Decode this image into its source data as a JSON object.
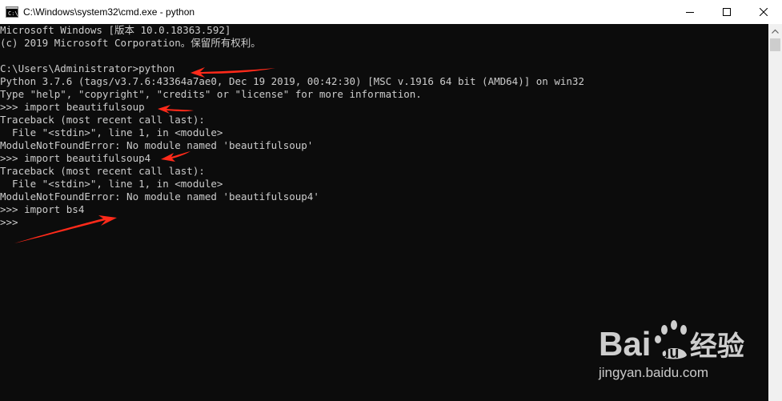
{
  "window": {
    "title": "C:\\Windows\\system32\\cmd.exe - python",
    "app_icon": "cmd-icon",
    "controls": {
      "minimize_icon": "minimize-icon",
      "maximize_icon": "maximize-icon",
      "close_icon": "close-icon"
    }
  },
  "console": {
    "lines": [
      "Microsoft Windows [版本 10.0.18363.592]",
      "(c) 2019 Microsoft Corporation。保留所有权利。",
      "",
      "C:\\Users\\Administrator>python",
      "Python 3.7.6 (tags/v3.7.6:43364a7ae0, Dec 19 2019, 00:42:30) [MSC v.1916 64 bit (AMD64)] on win32",
      "Type \"help\", \"copyright\", \"credits\" or \"license\" for more information.",
      ">>> import beautifulsoup",
      "Traceback (most recent call last):",
      "  File \"<stdin>\", line 1, in <module>",
      "ModuleNotFoundError: No module named 'beautifulsoup'",
      ">>> import beautifulsoup4",
      "Traceback (most recent call last):",
      "  File \"<stdin>\", line 1, in <module>",
      "ModuleNotFoundError: No module named 'beautifulsoup4'",
      ">>> import bs4",
      ">>>"
    ],
    "text_color": "#cccccc",
    "background_color": "#0c0c0c"
  },
  "annotations": {
    "arrow_color": "#ff2a1a",
    "arrow_count": 4
  },
  "watermark": {
    "logo_text": "Bai du 经验",
    "url_text": "jingyan.baidu.com"
  }
}
